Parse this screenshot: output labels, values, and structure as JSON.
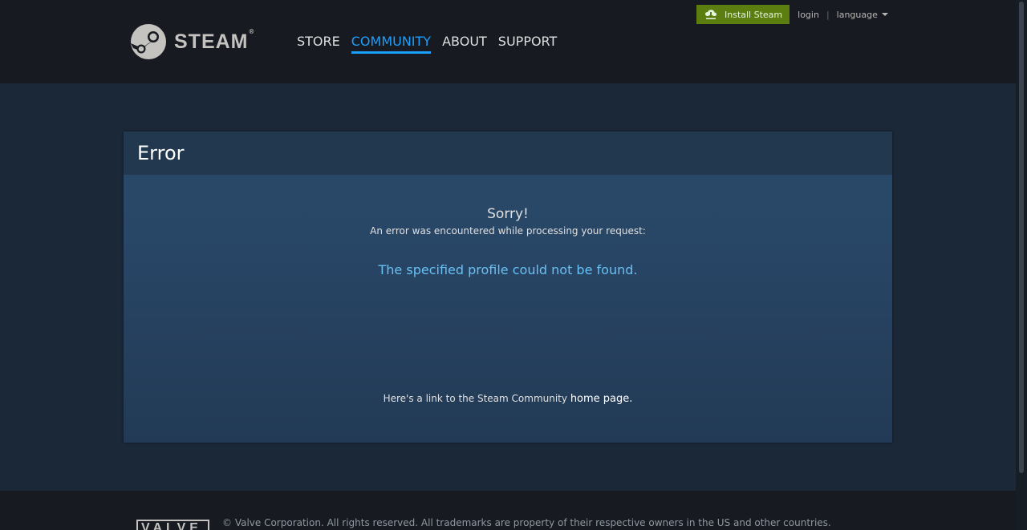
{
  "header": {
    "logo_text": "STEAM",
    "logo_reg": "®",
    "nav": [
      {
        "label": "STORE"
      },
      {
        "label": "COMMUNITY"
      },
      {
        "label": "ABOUT"
      },
      {
        "label": "SUPPORT"
      }
    ],
    "install_label": "Install Steam",
    "login_label": "login",
    "separator": "|",
    "language_label": "language"
  },
  "error": {
    "title": "Error",
    "sorry": "Sorry!",
    "subtitle": "An error was encountered while processing your request:",
    "message": "The specified profile could not be found.",
    "home_prefix": "Here's a link to the Steam Community ",
    "home_link": "home page",
    "home_suffix": "."
  },
  "footer": {
    "valve_logo": "VALVE",
    "copyright": "© Valve Corporation. All rights reserved. All trademarks are property of their respective owners in the US and other countries."
  },
  "colors": {
    "accent": "#1a9fff",
    "install_green": "#5c7e10",
    "error_message": "#67c1f5"
  }
}
